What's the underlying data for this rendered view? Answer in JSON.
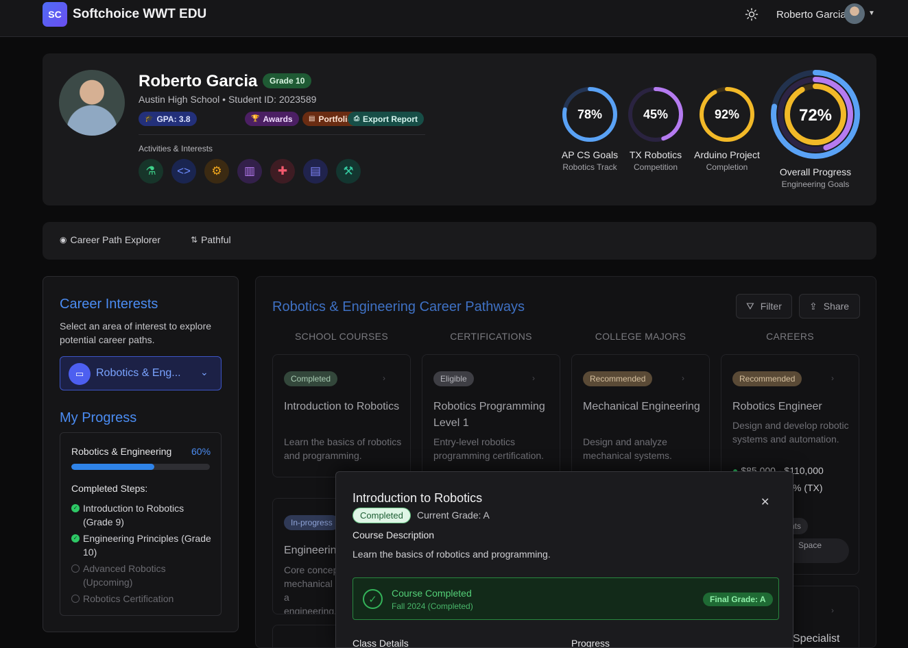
{
  "nav": {
    "logo": "SC",
    "brand": "Softchoice WWT EDU",
    "user_name": "Roberto Garcia"
  },
  "profile": {
    "name": "Roberto Garcia",
    "grade": "Grade 10",
    "school_line": "Austin High School • Student ID: 2023589",
    "pills": {
      "gpa": "GPA: 3.8",
      "awards": "Awards",
      "portfolio": "Portfolio Items",
      "export": "Export Report"
    },
    "activities_label": "Activities & Interests",
    "activities": [
      "flask-icon",
      "code-icon",
      "gear-icon",
      "piano-icon",
      "puzzle-icon",
      "chat-icon",
      "robot-arm-icon"
    ]
  },
  "rings": [
    {
      "pct_label": "78%",
      "value": 0.78,
      "label": "AP CS Goals",
      "sub": "Robotics Track",
      "color": "#5aa2f5"
    },
    {
      "pct_label": "45%",
      "value": 0.45,
      "label": "TX Robotics",
      "sub": "Competition",
      "color": "#b57bf0"
    },
    {
      "pct_label": "92%",
      "value": 0.92,
      "label": "Arduino Project",
      "sub": "Completion",
      "color": "#f2b928"
    }
  ],
  "overall": {
    "pct_label": "72%",
    "value": 0.72,
    "label": "Overall Progress",
    "sub": "Engineering Goals"
  },
  "tabs": [
    {
      "label": "Career Path Explorer",
      "icon": "compass-icon"
    },
    {
      "label": "Pathful",
      "icon": "route-icon"
    }
  ],
  "sidebar": {
    "interests_title": "Career Interests",
    "interests_desc": "Select an area of interest to explore potential career paths.",
    "selected_interest": "Robotics & Eng...",
    "progress_title": "My Progress",
    "progress": {
      "name": "Robotics & Engineering",
      "pct_label": "60%",
      "value": 0.6,
      "steps_title": "Completed Steps:",
      "steps": [
        {
          "label": "Introduction to Robotics (Grade 9)",
          "done": true
        },
        {
          "label": "Engineering Principles (Grade 10)",
          "done": true
        },
        {
          "label": "Advanced Robotics (Upcoming)",
          "done": false
        },
        {
          "label": "Robotics Certification",
          "done": false
        }
      ]
    }
  },
  "main": {
    "title": "Robotics & Engineering Career Pathways",
    "filter": "Filter",
    "share": "Share",
    "columns": [
      "SCHOOL COURSES",
      "CERTIFICATIONS",
      "COLLEGE MAJORS",
      "CAREERS"
    ],
    "cards": [
      {
        "badge": "Completed",
        "title": "Introduction to Robotics",
        "desc": "Learn the basics of robotics and programming."
      },
      {
        "badge": "Eligible",
        "title": "Robotics Programming Level 1",
        "desc": "Entry-level robotics programming certification."
      },
      {
        "badge": "Recommended",
        "title": "Mechanical Engineering",
        "desc": "Design and analyze mechanical systems."
      },
      {
        "badge": "Recommended",
        "title": "Robotics Engineer",
        "desc": "Design and develop robotic systems and automation.",
        "salary": "$85,000 - $110,000",
        "growth": "% (TX)"
      }
    ],
    "card2": {
      "badge": "In-progress",
      "title": "Engineerin",
      "desc": "Core concep mechanical a engineering."
    },
    "peek": {
      "tag_frag": "nts",
      "space_frag": "Space",
      "specialist_frag": "Specialist"
    }
  },
  "modal": {
    "title": "Introduction to Robotics",
    "status": "Completed",
    "current_grade": "Current Grade: A",
    "desc_heading": "Course Description",
    "desc": "Learn the basics of robotics and programming.",
    "banner_title": "Course Completed",
    "banner_sub": "Fall 2024 (Completed)",
    "final_grade": "Final Grade: A",
    "class_details": "Class Details",
    "progress": "Progress"
  }
}
